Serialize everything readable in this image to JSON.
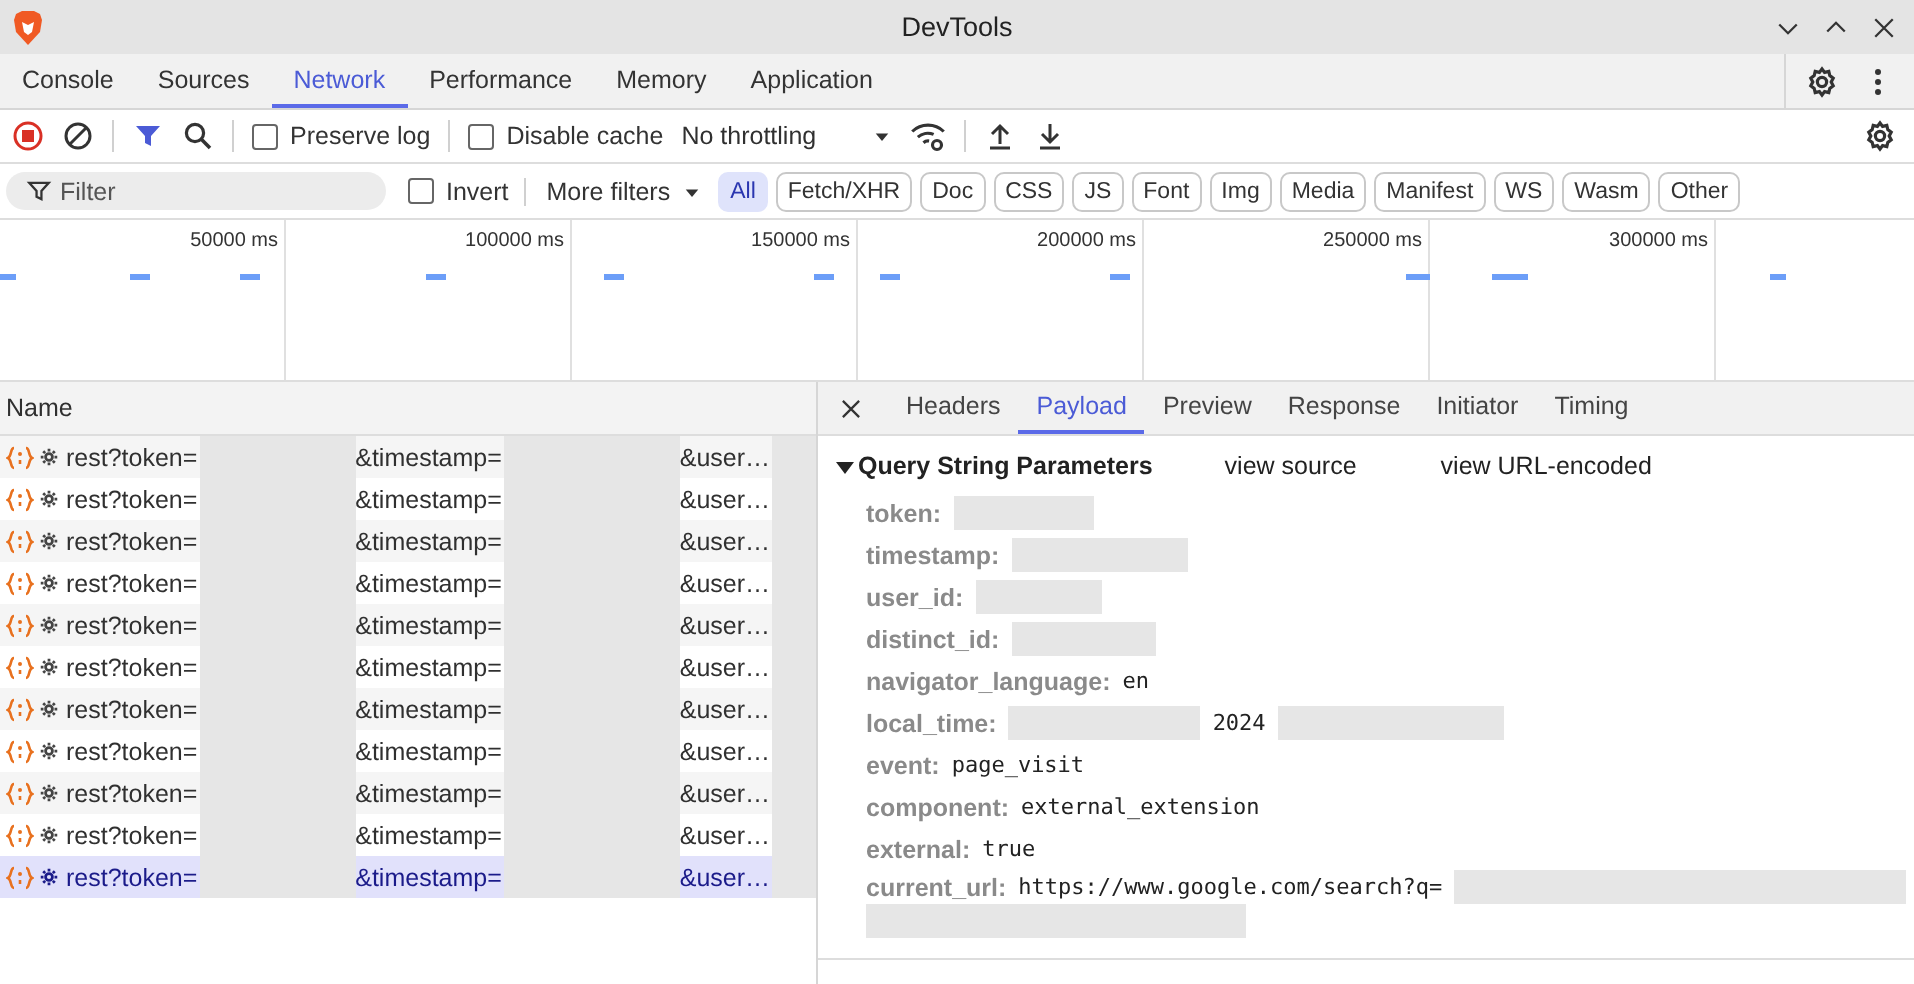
{
  "window": {
    "title": "DevTools"
  },
  "tabs": [
    {
      "label": "Console",
      "selected": false
    },
    {
      "label": "Sources",
      "selected": false
    },
    {
      "label": "Network",
      "selected": true
    },
    {
      "label": "Performance",
      "selected": false
    },
    {
      "label": "Memory",
      "selected": false
    },
    {
      "label": "Application",
      "selected": false
    }
  ],
  "toolbar": {
    "preserve_log": {
      "label": "Preserve log",
      "checked": false
    },
    "disable_cache": {
      "label": "Disable cache",
      "checked": false
    },
    "throttling": "No throttling"
  },
  "filter_bar": {
    "placeholder": "Filter",
    "invert": {
      "label": "Invert",
      "checked": false
    },
    "more_filters": "More filters",
    "types": [
      {
        "label": "All",
        "selected": true
      },
      {
        "label": "Fetch/XHR",
        "selected": false
      },
      {
        "label": "Doc",
        "selected": false
      },
      {
        "label": "CSS",
        "selected": false
      },
      {
        "label": "JS",
        "selected": false
      },
      {
        "label": "Font",
        "selected": false
      },
      {
        "label": "Img",
        "selected": false
      },
      {
        "label": "Media",
        "selected": false
      },
      {
        "label": "Manifest",
        "selected": false
      },
      {
        "label": "WS",
        "selected": false
      },
      {
        "label": "Wasm",
        "selected": false
      },
      {
        "label": "Other",
        "selected": false
      }
    ]
  },
  "overview": {
    "ticks": [
      "50000 ms",
      "100000 ms",
      "150000 ms",
      "200000 ms",
      "250000 ms",
      "300000 ms"
    ]
  },
  "requests": {
    "column": "Name",
    "rows": [
      {
        "parts": [
          "rest?token=",
          "&timestamp=",
          "&user…"
        ],
        "selected": false
      },
      {
        "parts": [
          "rest?token=",
          "&timestamp=",
          "&user…"
        ],
        "selected": false
      },
      {
        "parts": [
          "rest?token=",
          "&timestamp=",
          "&user…"
        ],
        "selected": false
      },
      {
        "parts": [
          "rest?token=",
          "&timestamp=",
          "&user…"
        ],
        "selected": false
      },
      {
        "parts": [
          "rest?token=",
          "&timestamp=",
          "&user…"
        ],
        "selected": false
      },
      {
        "parts": [
          "rest?token=",
          "&timestamp=",
          "&user…"
        ],
        "selected": false
      },
      {
        "parts": [
          "rest?token=",
          "&timestamp=",
          "&user…"
        ],
        "selected": false
      },
      {
        "parts": [
          "rest?token=",
          "&timestamp=",
          "&user…"
        ],
        "selected": false
      },
      {
        "parts": [
          "rest?token=",
          "&timestamp=",
          "&user…"
        ],
        "selected": false
      },
      {
        "parts": [
          "rest?token=",
          "&timestamp=",
          "&user…"
        ],
        "selected": false
      },
      {
        "parts": [
          "rest?token=",
          "&timestamp=",
          "&user…"
        ],
        "selected": true
      }
    ]
  },
  "detail": {
    "tabs": [
      {
        "label": "Headers",
        "selected": false
      },
      {
        "label": "Payload",
        "selected": true
      },
      {
        "label": "Preview",
        "selected": false
      },
      {
        "label": "Response",
        "selected": false
      },
      {
        "label": "Initiator",
        "selected": false
      },
      {
        "label": "Timing",
        "selected": false
      }
    ],
    "section": {
      "title": "Query String Parameters",
      "expanded": true,
      "links": [
        "view source",
        "view URL-encoded"
      ],
      "params": [
        {
          "key": "token:",
          "value": [
            {
              "kind": "redacted"
            }
          ]
        },
        {
          "key": "timestamp:",
          "value": [
            {
              "kind": "redacted"
            }
          ]
        },
        {
          "key": "user_id:",
          "value": [
            {
              "kind": "redacted"
            }
          ]
        },
        {
          "key": "distinct_id:",
          "value": [
            {
              "kind": "redacted"
            }
          ]
        },
        {
          "key": "navigator_language:",
          "value": [
            {
              "kind": "text",
              "text": "en"
            }
          ]
        },
        {
          "key": "local_time:",
          "value": [
            {
              "kind": "redacted"
            },
            {
              "kind": "text",
              "text": "2024"
            },
            {
              "kind": "redacted"
            }
          ]
        },
        {
          "key": "event:",
          "value": [
            {
              "kind": "text",
              "text": "page_visit"
            }
          ]
        },
        {
          "key": "component:",
          "value": [
            {
              "kind": "text",
              "text": "external_extension"
            }
          ]
        },
        {
          "key": "external:",
          "value": [
            {
              "kind": "text",
              "text": "true"
            }
          ]
        },
        {
          "key": "current_url:",
          "value": [
            {
              "kind": "text",
              "text": "https://www.google.com/search?q="
            },
            {
              "kind": "redacted"
            },
            {
              "kind": "redacted"
            }
          ]
        }
      ]
    }
  }
}
